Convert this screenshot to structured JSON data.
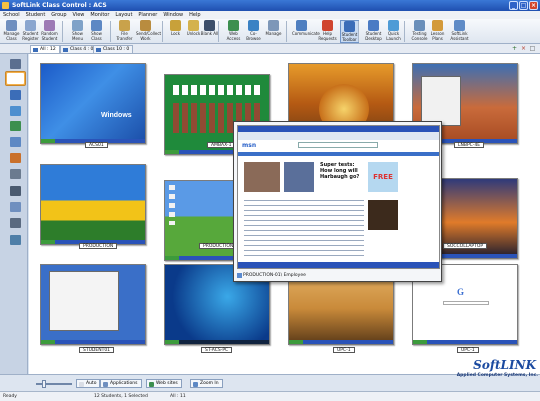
{
  "window": {
    "title": "SoftLink Class Control : ACS"
  },
  "menu": [
    "School",
    "Student",
    "Group",
    "View",
    "Monitor",
    "Layout",
    "Planner",
    "Window",
    "Help"
  ],
  "toolbar": [
    {
      "label": "Manage Class",
      "icon": "manage-class-icon",
      "color": "#6f8fbf"
    },
    {
      "label": "Student Register",
      "icon": "register-icon",
      "color": "#8aa6cf"
    },
    {
      "label": "Random Student",
      "icon": "random-student-icon",
      "color": "#9d7ab5"
    },
    {
      "label": "Show Menu",
      "icon": "show-menu-icon",
      "color": "#7fa2c8"
    },
    {
      "label": "Show Class",
      "icon": "show-class-icon",
      "color": "#5d88c4"
    },
    {
      "label": "File Transfer",
      "icon": "file-transfer-icon",
      "color": "#c9a24b"
    },
    {
      "label": "Send/Collect Work",
      "icon": "send-collect-icon",
      "color": "#b98c3f"
    },
    {
      "label": "Lock",
      "icon": "lock-icon",
      "color": "#c8a13a"
    },
    {
      "label": "Unlock",
      "icon": "unlock-icon",
      "color": "#d4b24d"
    },
    {
      "label": "Blank All",
      "icon": "blank-all-icon",
      "color": "#3c4f6b"
    },
    {
      "label": "Web Access",
      "icon": "web-access-icon",
      "color": "#3c8f4f"
    },
    {
      "label": "Co-Browse",
      "icon": "co-browse-icon",
      "color": "#3b82c4"
    },
    {
      "label": "Manage",
      "icon": "manage-icon",
      "color": "#7d97b8"
    },
    {
      "label": "Communicate",
      "icon": "communicate-icon",
      "color": "#4f7fc0"
    },
    {
      "label": "Help Requests",
      "icon": "help-requests-icon",
      "color": "#d0452f"
    },
    {
      "label": "Student Toolbar",
      "icon": "student-toolbar-icon",
      "color": "#3b6db8"
    },
    {
      "label": "Student Desktop",
      "icon": "student-desktop-icon",
      "color": "#4a7bc4"
    },
    {
      "label": "Quick Launch",
      "icon": "quick-launch-icon",
      "color": "#4e9bd6"
    },
    {
      "label": "Testing Console",
      "icon": "testing-console-icon",
      "color": "#6a8fba"
    },
    {
      "label": "Lesson Plans",
      "icon": "lesson-plans-icon",
      "color": "#d39a3a"
    },
    {
      "label": "SoftLink Assistant",
      "icon": "assistant-icon",
      "color": "#5f8bc6"
    }
  ],
  "tabs": [
    {
      "label": "All : 12",
      "active": true
    },
    {
      "label": "Class 4 : 0",
      "active": false
    },
    {
      "label": "Class 10 : 0",
      "active": false
    }
  ],
  "tab_controls": [
    "+",
    "×",
    "□"
  ],
  "sidebar": [
    "home-icon",
    "thumbnails-icon",
    "audio-icon",
    "headset-icon",
    "web-icon",
    "applications-icon",
    "monitor-icon",
    "print-icon",
    "camera-icon",
    "search-icon",
    "usb-icon",
    "monitor-activity-icon"
  ],
  "students": [
    {
      "name": "ACS01",
      "screen": "xp-blue"
    },
    {
      "name": "AMBAX-1",
      "screen": "solitaire"
    },
    {
      "name": "",
      "screen": "autumn"
    },
    {
      "name": "LNBPC-4E",
      "screen": "desert"
    },
    {
      "name": "PRODUCTION",
      "screen": "tulips"
    },
    {
      "name": "PRODUCTION-01",
      "screen": "bliss"
    },
    {
      "name": "SOCCOLLAPTOP",
      "screen": "sunset"
    },
    {
      "name": "STUDENT01",
      "screen": "explorer"
    },
    {
      "name": "ST-ACS-PC",
      "screen": "vista"
    },
    {
      "name": "UPC-1",
      "screen": "coastal"
    },
    {
      "name": "UPC-1",
      "screen": "google"
    }
  ],
  "popup": {
    "label": "PRODUCTION-01\\ Employee",
    "headline": "Super tests: How long will Harbaugh go?",
    "free_badge": "FREE"
  },
  "bottombar": {
    "auto": "Auto",
    "applications": "Applications",
    "web_sites": "Web sites",
    "zoom": "Zoom In"
  },
  "brand": {
    "name": "SoftLINK",
    "company": "Applied Computer Systems, Inc."
  },
  "status": {
    "left": "Ready",
    "students": "12 Students, 1 Selected",
    "count": "All : 11"
  }
}
